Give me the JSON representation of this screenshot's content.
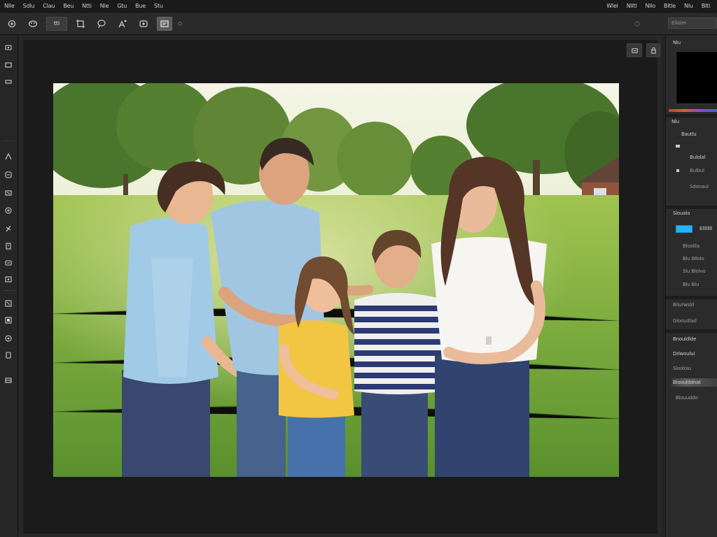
{
  "menubar": {
    "items": [
      "Nlle",
      "Sdlu",
      "Clau",
      "Beu",
      "Ntti",
      "Nle",
      "Gtu",
      "Bue",
      "Stu"
    ],
    "right_items": [
      "Wlel",
      "Nlltl",
      "Nllo",
      "Bltle",
      "Nlu",
      "Bltl"
    ]
  },
  "options": {
    "tools": [
      {
        "icon": "gear-icon"
      },
      {
        "icon": "brush-icon"
      },
      {
        "icon": "selection-icon",
        "label": "ttl"
      },
      {
        "icon": "crop-icon"
      },
      {
        "icon": "lasso-icon"
      },
      {
        "icon": "pen-icon"
      },
      {
        "icon": "hand-icon"
      },
      {
        "icon": "layers-icon"
      },
      {
        "icon": "zoom-icon"
      }
    ],
    "search_value": "Ellolm"
  },
  "canvas": {
    "float_buttons": [
      "expand-icon",
      "lock-icon"
    ]
  },
  "right_panel": {
    "header": "Nlu",
    "section1_title": "Nlu",
    "section1_items": [
      "Bautlu",
      "Bulolal",
      "Bulbul",
      "Sdonaul"
    ],
    "section2_title": "Slouala",
    "section2_items": [
      "Ellllllll",
      "Bloollla",
      "Blu Bllolo",
      "Slu Blolvo",
      "Blu Blu"
    ],
    "section3_items": [
      "Bilurwsld",
      "Glooudlad"
    ],
    "section4_items": [
      "Bnouldlde",
      "Drlwoului",
      "Slooloiu",
      "Blooulddnat",
      "Blouuddo"
    ]
  },
  "colors": {
    "accent": "#22b4ff",
    "bg": "#232323"
  }
}
